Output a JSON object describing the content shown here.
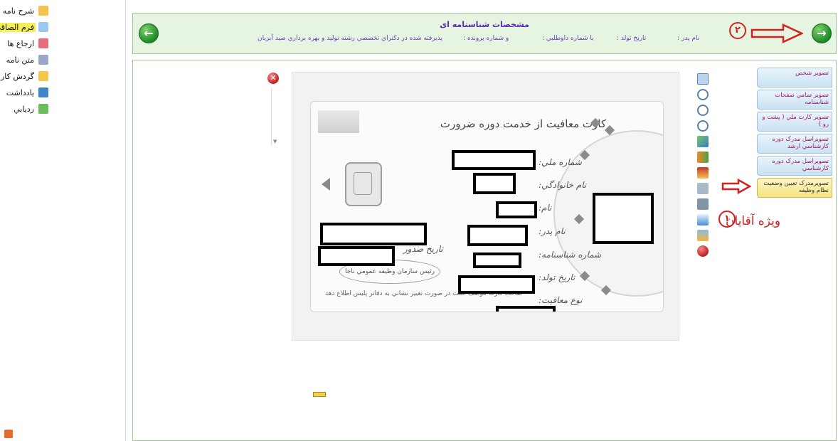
{
  "sidebar": {
    "items": [
      {
        "label": "شرح نامه",
        "icon": "envelope-icon",
        "active": false
      },
      {
        "label": "فرم الصاقي",
        "icon": "document-icon",
        "active": true
      },
      {
        "label": "ارجاع ها",
        "icon": "forward-icon",
        "active": false
      },
      {
        "label": "متن نامه",
        "icon": "pen-icon",
        "active": false
      },
      {
        "label": "گردش کار",
        "icon": "workflow-icon",
        "active": false
      },
      {
        "label": "يادداشت",
        "icon": "note-icon",
        "active": false
      },
      {
        "label": "رديابي",
        "icon": "track-icon",
        "active": false
      }
    ]
  },
  "header": {
    "title": "مشخصات شناسنامه اى",
    "fields": {
      "father": "نام پدر :",
      "birthdate": "تاريخ تولد :",
      "applicant_no": "با شماره داوطلبي :",
      "file_no": "و شماره پرونده :",
      "accepted": "پذيرفته شده در دکتراي تخصصي رشته توليد و بهره برداري صيد آبزيان"
    },
    "annotation_number": "۲"
  },
  "tabs": [
    {
      "label": "تصوير شخص",
      "active": false
    },
    {
      "label": "تصوير تمامي صفحات شناسنامه",
      "active": false
    },
    {
      "label": "تصوير کارت ملي ( پشت و رو )",
      "active": false
    },
    {
      "label": "تصويراصل مدرک دوره کارشناسي ارشد",
      "active": false
    },
    {
      "label": "تصويراصل مدرک دوره کارشناسي",
      "active": false
    },
    {
      "label": "تصويرمدرک تعيين وضعيت نظام وظيفه",
      "active": true
    }
  ],
  "annotation": {
    "men_label": "ويژه آقايان",
    "number": "۱"
  },
  "card": {
    "heading": "کارت معافيت از خدمت دوره ضرورت",
    "labels": {
      "card_no": "شماره ملي:",
      "lastname": "نام خانوادگي:",
      "name": "نام:",
      "father": "نام پدر:",
      "id_no": "شماره شناسنامه:",
      "birth": "تاريخ تولد:",
      "exemption": "نوع معافيت:",
      "issue_date": "تاريخ صدور"
    },
    "stamp": "رئيس سازمان وظيفه عمومي ناجا",
    "footer": "صاحب کارت موظف است در صورت تغيير نشاني به دفاتر پليس اطلاع دهد"
  },
  "toolbar": {
    "icons": [
      "list-icon",
      "zoom-in-icon",
      "zoom-out-icon",
      "zoom-reset-icon",
      "rotate-icon",
      "swap-icon",
      "pdf-icon",
      "print-icon",
      "scanner-icon",
      "file-icon",
      "camera-icon",
      "delete-icon"
    ]
  },
  "colors": {
    "header_bg": "#e5f5e1",
    "accent": "#5a2ab0",
    "annotation_red": "#d42020",
    "tab_active": "#f4e47e"
  }
}
